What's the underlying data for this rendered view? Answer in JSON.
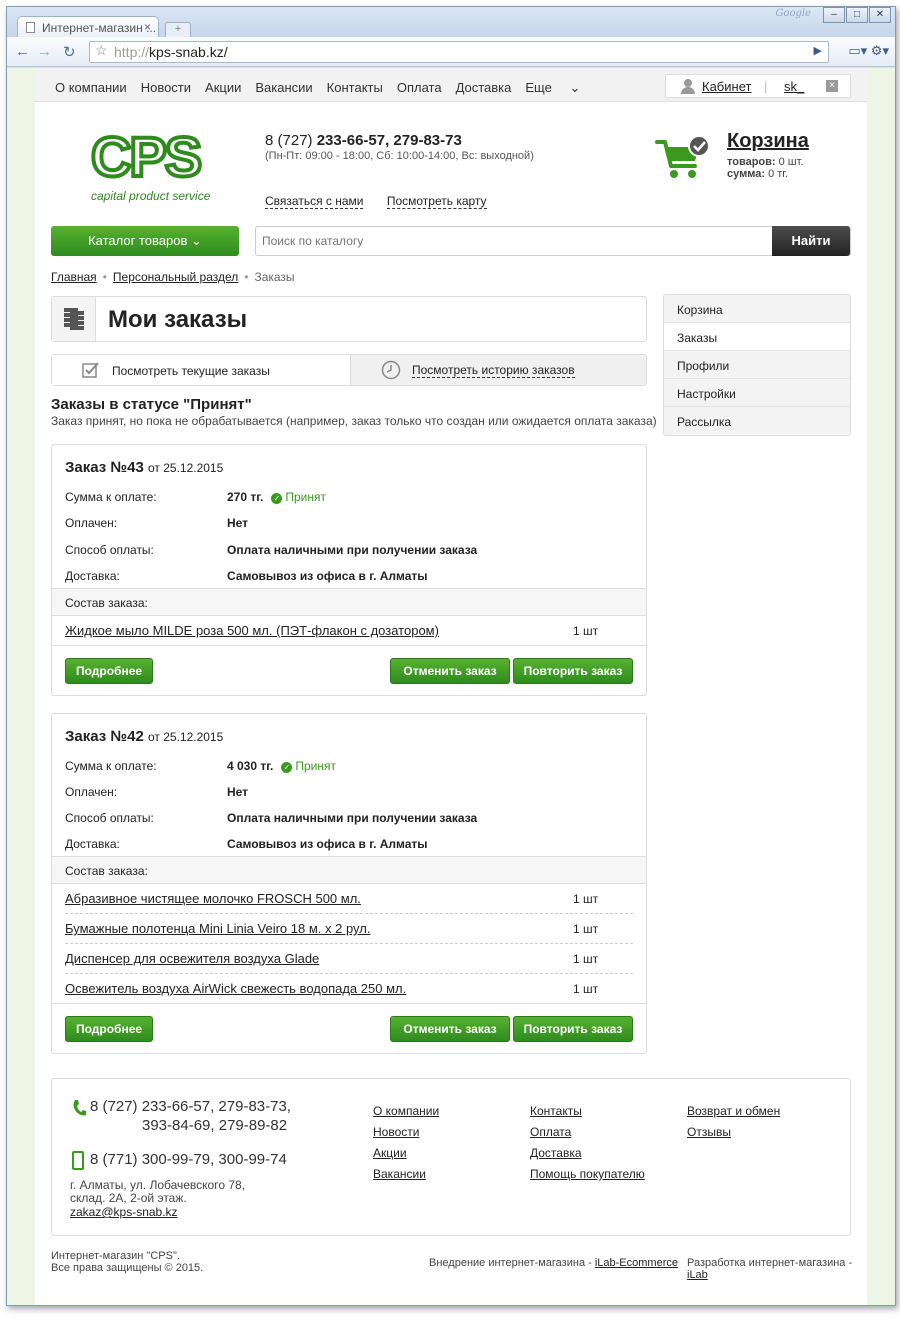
{
  "browser": {
    "tab_title": "Интернет-магазин ...",
    "brand_label": "Google",
    "url_scheme": "http://",
    "url_host": "kps-snab.kz/"
  },
  "topnav": {
    "items": [
      "О компании",
      "Новости",
      "Акции",
      "Вакансии",
      "Контакты",
      "Оплата",
      "Доставка",
      "Еще"
    ],
    "cabinet_label": "Кабинет",
    "username": "sk_"
  },
  "logo": {
    "text": "CPS",
    "tagline": "capital product service"
  },
  "header": {
    "phone_prefix": "8 (727) ",
    "phone_numbers": "233-66-57, 279-83-73",
    "hours": "(Пн-Пт: 09:00 - 18:00,  Сб: 10:00-14:00, Вс: выходной)",
    "contact_link": "Связаться с нами",
    "map_link": "Посмотреть карту"
  },
  "cart": {
    "title": "Корзина",
    "items_label": "товаров:",
    "items_value": "0 шт.",
    "sum_label": "сумма:",
    "sum_value": "0 тг."
  },
  "catalog": {
    "button_label": "Каталог товаров",
    "search_placeholder": "Поиск по каталогу",
    "search_button": "Найти"
  },
  "breadcrumbs": [
    "Главная",
    "Персональный раздел",
    "Заказы"
  ],
  "page_title": "Мои заказы",
  "tabs": {
    "current": "Посмотреть текущие заказы",
    "history": "Посмотреть историю заказов"
  },
  "status": {
    "title": "Заказы в статусе \"Принят\"",
    "description": "Заказ принят, но пока не обрабатывается (например, заказ только что создан или ожидается оплата заказа)"
  },
  "labels": {
    "sum": "Сумма к оплате:",
    "paid": "Оплачен:",
    "pay_method": "Способ оплаты:",
    "delivery": "Доставка:",
    "composition": "Состав заказа:",
    "details_btn": "Подробнее",
    "cancel_btn": "Отменить заказ",
    "repeat_btn": "Повторить заказ"
  },
  "orders": [
    {
      "number": "Заказ №43",
      "date": "от 25.12.2015",
      "sum": "270 тг.",
      "status": "Принят",
      "paid": "Нет",
      "pay_method": "Оплата наличными при получении заказа",
      "delivery": "Самовывоз из офиса в г. Алматы",
      "items": [
        {
          "name": "Жидкое мыло MILDE роза 500 мл. (ПЭТ-флакон с дозатором)",
          "qty": "1 шт"
        }
      ]
    },
    {
      "number": "Заказ №42",
      "date": "от 25.12.2015",
      "sum": "4 030 тг.",
      "status": "Принят",
      "paid": "Нет",
      "pay_method": "Оплата наличными при получении заказа",
      "delivery": "Самовывоз из офиса в г. Алматы",
      "items": [
        {
          "name": "Абразивное чистящее молочко FROSCH 500 мл.",
          "qty": "1 шт"
        },
        {
          "name": "Бумажные полотенца Mini Linia Veiro 18 м. х 2 рул.",
          "qty": "1 шт"
        },
        {
          "name": "Диспенсер для освежителя воздуха Glade",
          "qty": "1 шт"
        },
        {
          "name": "Освежитель воздуха AirWick свежесть водопада 250 мл.",
          "qty": "1 шт"
        }
      ]
    }
  ],
  "sidebar": [
    "Корзина",
    "Заказы",
    "Профили",
    "Настройки",
    "Рассылка"
  ],
  "footer": {
    "phones_line1": "8 (727) 233-66-57, 279-83-73,",
    "phones_line2": "393-84-69, 279-89-82",
    "mobile": "8 (771) 300-99-79, 300-99-74",
    "address_line1": "г. Алматы, ул. Лобачевского 78,",
    "address_line2": "склад. 2А, 2-ой этаж.",
    "email": "zakaz@kps-snab.kz",
    "col1": [
      "О компании",
      "Новости",
      "Акции",
      "Вакансии"
    ],
    "col2": [
      "Контакты",
      "Оплата",
      "Доставка",
      "Помощь покупателю"
    ],
    "col3": [
      "Возврат и обмен",
      "Отзывы"
    ],
    "copyright_line1": "Интернет-магазин \"CPS\".",
    "copyright_line2": "Все права защищены © 2015.",
    "impl_prefix": "Внедрение интернет-магазина - ",
    "impl_link": "iLab-Ecommerce",
    "dev_prefix": "Разработка интернет-магазина - ",
    "dev_link": "iLab"
  },
  "colors": {
    "brand_green": "#2f8b1e",
    "status_green": "#3a9a1e",
    "page_bg": "#eef5e4"
  }
}
